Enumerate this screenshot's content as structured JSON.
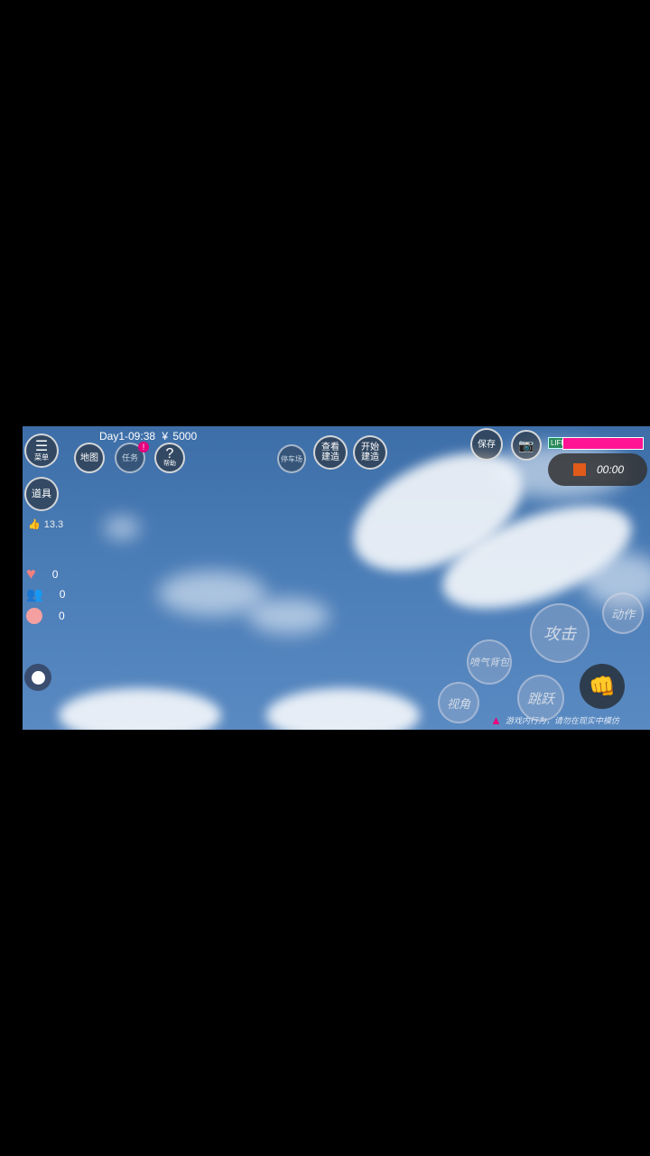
{
  "hud": {
    "menu_label": "菜单",
    "map_label": "地图",
    "task_label": "任务",
    "help_label": "帮助",
    "items_label": "道具",
    "status_line": "Day1-09:38",
    "currency_symbol": "¥",
    "currency_value": "5000",
    "fps_value": "13.3",
    "save_label": "保存",
    "life_label": "LIFE",
    "life_fraction": 1.0,
    "colors": {
      "life_bar": "#ff1493",
      "alert": "#e6007e",
      "record": "#e05a1a"
    }
  },
  "center_buttons": {
    "stop_label": "停车场",
    "view_build_label": "查看\n建造",
    "start_build_label": "开始\n建造"
  },
  "recorder": {
    "time": "00:00"
  },
  "stats": {
    "likes": "0",
    "friends": "0",
    "anger": "0"
  },
  "controls": {
    "attack_label": "攻击",
    "action_label": "动作",
    "air_label": "喷气背包",
    "jump_label": "跳跃",
    "view_label": "视角"
  },
  "footer": {
    "warning": "游戏内行为，请勿在现实中模仿"
  }
}
